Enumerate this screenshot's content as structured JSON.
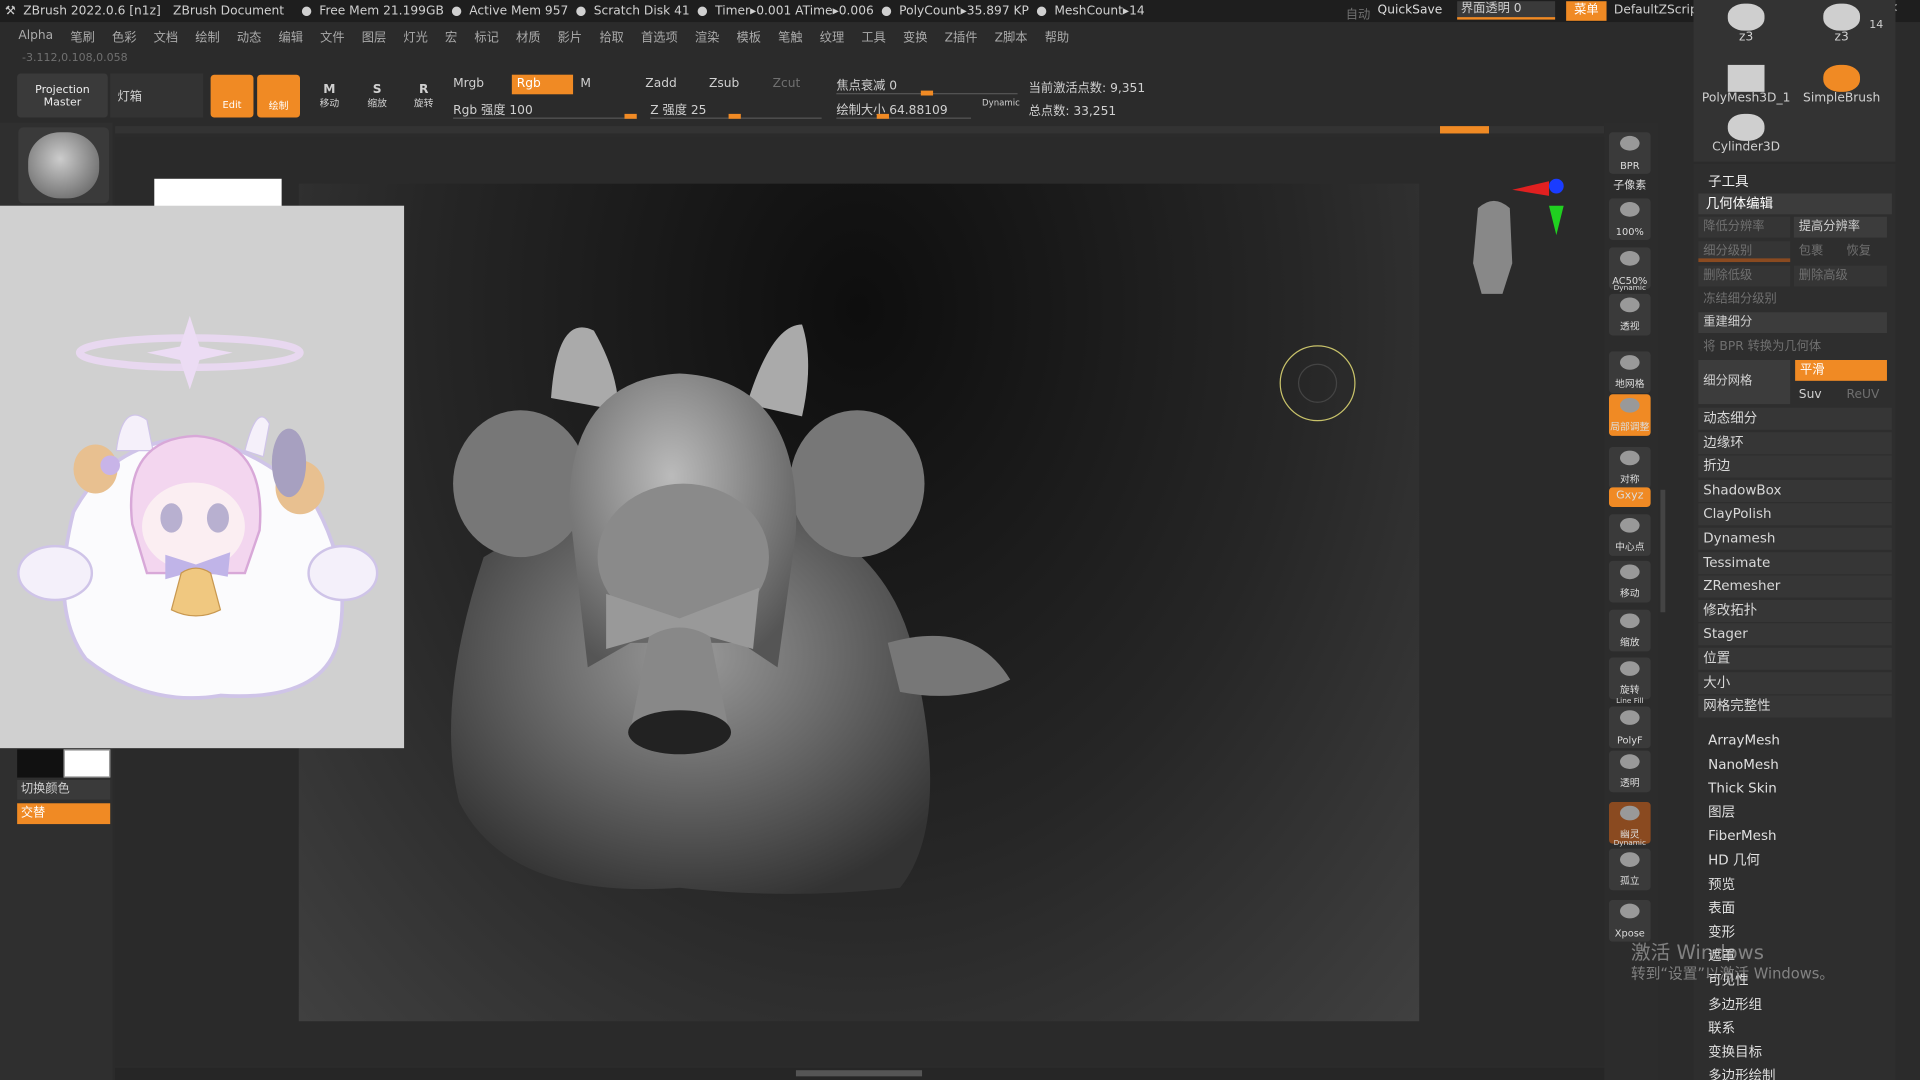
{
  "titlebar": {
    "app": "ZBrush 2022.0.6 [n1z]",
    "doc": "ZBrush Document",
    "free_mem": "Free Mem 21.199GB",
    "active_mem": "Active Mem 957",
    "scratch": "Scratch Disk 41",
    "timer": "Timer▸0.001 ATime▸0.006",
    "polycount": "PolyCount▸35.897 KP",
    "meshcount": "MeshCount▸14",
    "auto": "自动",
    "quicksave": "QuickSave",
    "ui_transparency": "界面透明 0",
    "menu": "菜单",
    "script": "DefaultZScript"
  },
  "menubar": [
    "Alpha",
    "笔刷",
    "色彩",
    "文档",
    "绘制",
    "动态",
    "编辑",
    "文件",
    "图层",
    "灯光",
    "宏",
    "标记",
    "材质",
    "影片",
    "拾取",
    "首选项",
    "渲染",
    "模板",
    "笔触",
    "纹理",
    "工具",
    "变换",
    "Z插件",
    "Z脚本",
    "帮助"
  ],
  "coords": "-3.112,0.108,0.058",
  "toolbar": {
    "projection_master": "Projection Master",
    "lightbox": "灯箱",
    "edit": "Edit",
    "draw": "绘制",
    "move": "移动",
    "scale": "缩放",
    "rotate": "旋转",
    "mrgb": "Mrgb",
    "rgb": "Rgb",
    "m": "M",
    "rgb_intensity": "Rgb 强度 100",
    "zadd": "Zadd",
    "zsub": "Zsub",
    "zcut": "Zcut",
    "z_intensity": "Z 强度 25",
    "focal_shift": "焦点衰减 0",
    "draw_size": "绘制大小 64.88109",
    "dynamic": "Dynamic",
    "active_points": "当前激活点数: 9,351",
    "total_points": "总点数: 33,251"
  },
  "left": {
    "switch_color": "切换颜色",
    "alternate": "交替"
  },
  "shelf": [
    {
      "label": "BPR"
    },
    {
      "label": "子像素"
    },
    {
      "label": "100%"
    },
    {
      "label": "AC50%"
    },
    {
      "label": "透视",
      "top": "Dynamic"
    },
    {
      "label": "地网格"
    },
    {
      "label": "局部调整",
      "active": true
    },
    {
      "label": "对称"
    },
    {
      "label": "Gxyz",
      "active": true
    },
    {
      "label": "中心点"
    },
    {
      "label": "移动"
    },
    {
      "label": "缩放"
    },
    {
      "label": "旋转"
    },
    {
      "label": "PolyF",
      "top": "Line Fill"
    },
    {
      "label": "透明"
    },
    {
      "label": "幽灵"
    },
    {
      "label": "孤立",
      "top": "Dynamic"
    },
    {
      "label": "Xpose"
    }
  ],
  "tools": [
    {
      "name": "z3"
    },
    {
      "name": "z3",
      "count": "14"
    },
    {
      "name": "PolyMesh3D_1"
    },
    {
      "name": "SimpleBrush"
    },
    {
      "name": "Cylinder3D"
    }
  ],
  "panel": {
    "subtool": "子工具",
    "geometry": "几何体编辑",
    "lower_res": "降低分辨率",
    "higher_res": "提高分辨率",
    "sdiv": "细分级别",
    "cage": "包裹",
    "rstr": "恢复",
    "del_lower": "删除低级",
    "del_higher": "删除高级",
    "freeze": "冻结细分级别",
    "reconstruct": "重建细分",
    "bpr_to_geo": "将 BPR 转换为几何体",
    "divide": "细分网格",
    "smooth": "平滑",
    "suv": "Suv",
    "reuv": "ReUV",
    "items": [
      "动态细分",
      "边缘环",
      "折边",
      "ShadowBox",
      "ClayPolish",
      "Dynamesh",
      "Tessimate",
      "ZRemesher",
      "修改拓扑",
      "Stager",
      "位置",
      "大小",
      "网格完整性"
    ],
    "items2": [
      "ArrayMesh",
      "NanoMesh",
      "Thick Skin",
      "图层",
      "FiberMesh",
      "HD 几何",
      "预览",
      "表面",
      "变形",
      "遮罩",
      "可见性",
      "多边形组",
      "联系",
      "变换目标",
      "多边形绘制"
    ]
  },
  "watermark": {
    "line1": "激活 Windows",
    "line2": "转到“设置”以激活 Windows。"
  },
  "colors": {
    "accent": "#f08a24",
    "bg": "#2b2b2b"
  }
}
